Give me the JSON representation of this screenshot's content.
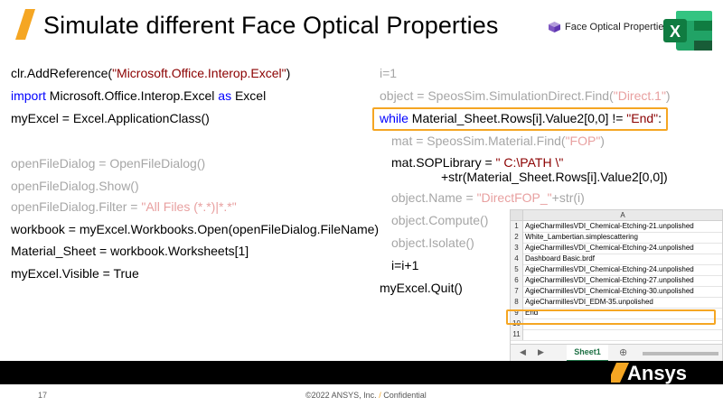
{
  "slide": {
    "title": "Simulate different Face Optical Properties",
    "page_number": "17",
    "footer": {
      "copyright": "©2022 ANSYS, Inc.",
      "separator": "/",
      "confidential": "Confidential"
    }
  },
  "fop_tag": {
    "label": "Face Optical Properties",
    "icon": "fop-cube-icon"
  },
  "excel_logo": {
    "letter": "X"
  },
  "left_code": [
    {
      "text": "clr.AddReference(",
      "str": "\"Microsoft.Office.Interop.Excel\"",
      "end": ")"
    },
    {
      "kw": "import",
      "text": " Microsoft.Office.Interop.Excel ",
      "kw2": "as",
      "text2": " Excel"
    },
    {
      "text": "myExcel = Excel.ApplicationClass()"
    },
    {
      "gray": "openFileDialog = OpenFileDialog()"
    },
    {
      "gray": "openFileDialog.Show()"
    },
    {
      "gray": "openFileDialog.Filter = ",
      "str": "\"All Files (*.*)|*.*\""
    },
    {
      "text": "workbook = myExcel.Workbooks.Open(openFileDialog.FileName)"
    },
    {
      "text": "Material_Sheet = workbook.Worksheets[1]"
    },
    {
      "text": "myExcel.Visible = True"
    }
  ],
  "right_code": {
    "l1": "i=1",
    "l2_a": "object = SpeosSim.SimulationDirect.Find(",
    "l2_b": "\"Direct.1\"",
    "l2_c": ")",
    "l3_kw": "while",
    "l3_a": " Material_Sheet.Rows[i].Value2[0,0] != ",
    "l3_b": "\"End\"",
    "l3_c": ":",
    "l4_a": "mat = SpeosSim.Material.Find(",
    "l4_b": "\"FOP\"",
    "l4_c": ")",
    "l5_a": "mat.SOPLibrary = ",
    "l5_b": "\" C:\\PATH \\\"",
    "l6": "+str(Material_Sheet.Rows[i].Value2[0,0])",
    "l7_a": "object.Name = ",
    "l7_b": "\"DirectFOP_\"",
    "l7_c": "+str(i)",
    "l8": "object.Compute()",
    "l9": "object.Isolate()",
    "l10": "i=i+1",
    "l11": "myExcel.Quit()"
  },
  "spreadsheet": {
    "column_header": "A",
    "rows": [
      {
        "n": "1",
        "v": "AgieCharmillesVDI_Chemical-Etching-21.unpolished"
      },
      {
        "n": "2",
        "v": "White_Lambertian.simplescattering"
      },
      {
        "n": "3",
        "v": "AgieCharmillesVDI_Chemical-Etching-24.unpolished"
      },
      {
        "n": "4",
        "v": "Dashboard Basic.brdf"
      },
      {
        "n": "5",
        "v": "AgieCharmillesVDI_Chemical-Etching-24.unpolished"
      },
      {
        "n": "6",
        "v": "AgieCharmillesVDI_Chemical-Etching-27.unpolished"
      },
      {
        "n": "7",
        "v": "AgieCharmillesVDI_Chemical-Etching-30.unpolished"
      },
      {
        "n": "8",
        "v": "AgieCharmillesVDI_EDM-35.unpolished"
      },
      {
        "n": "9",
        "v": "End"
      },
      {
        "n": "10",
        "v": ""
      },
      {
        "n": "11",
        "v": ""
      }
    ],
    "sheet_tab": "Sheet1",
    "add_sheet": "⊕",
    "nav_prev": "◀",
    "nav_next": "▶"
  },
  "brand": {
    "name": "Ansys"
  },
  "colors": {
    "accent": "#f5a623",
    "excel_green": "#1e7145",
    "keyword_blue": "#0000ff",
    "string_maroon": "#8b0000"
  }
}
